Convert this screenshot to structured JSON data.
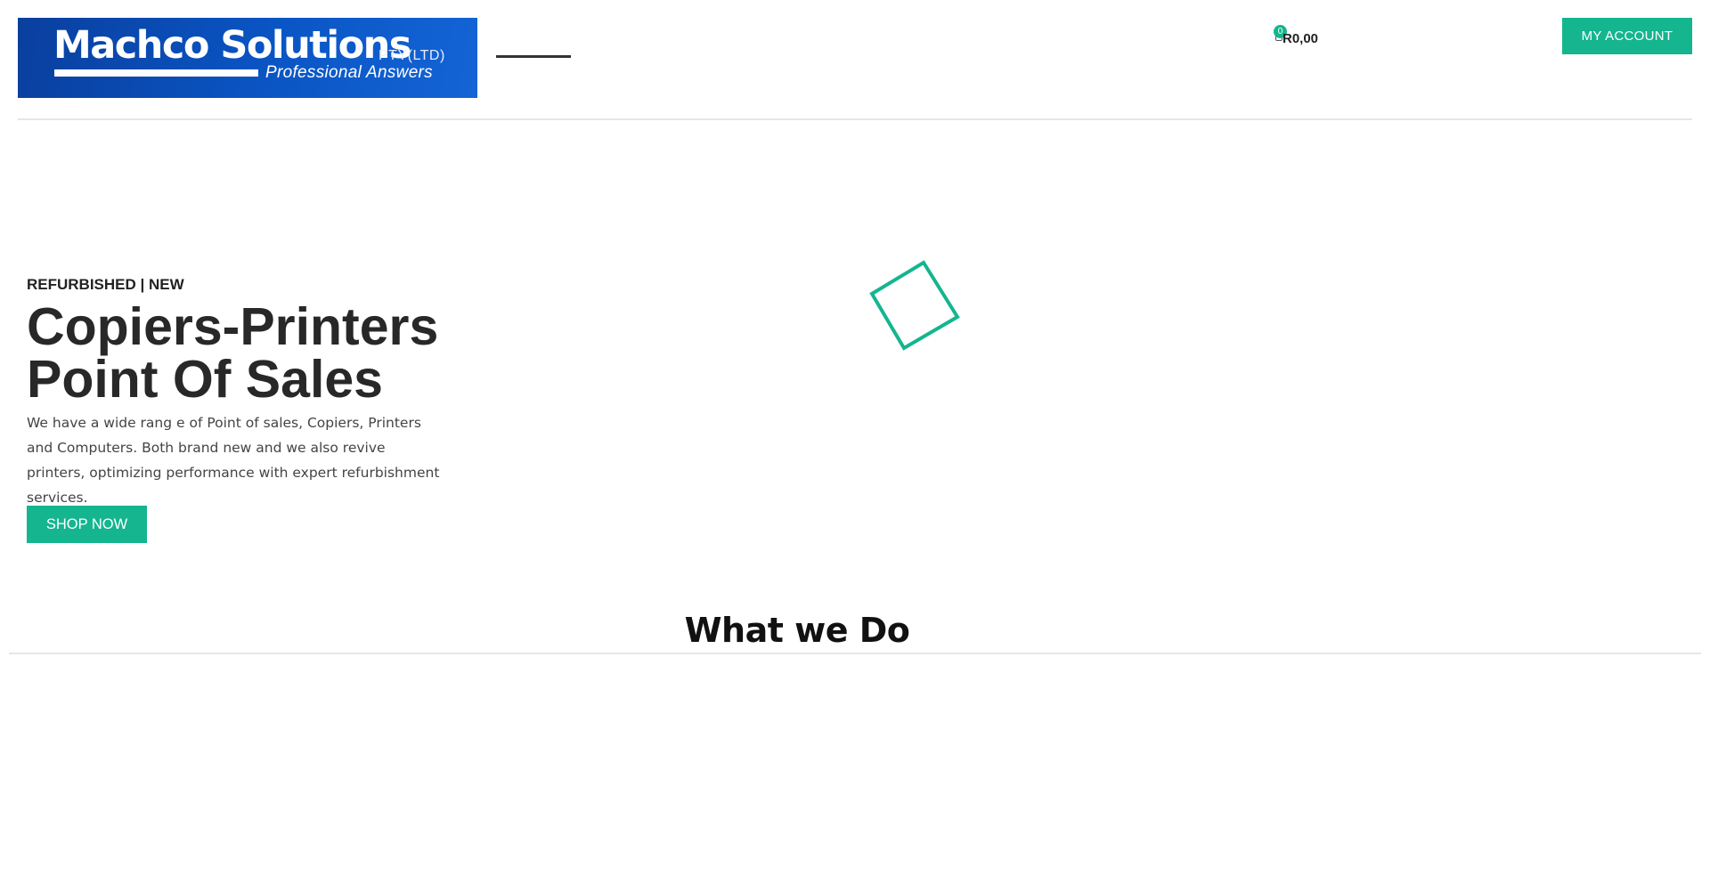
{
  "header": {
    "logo": {
      "brand": "Machco Solutions",
      "suffix": "PTY(LTD)",
      "tagline": "Professional Answers"
    },
    "cart": {
      "count": "0",
      "total": "R0,00",
      "icon": "cart-icon"
    },
    "account_label": "MY ACCOUNT"
  },
  "hero": {
    "eyebrow": "REFURBISHED | NEW",
    "title_line1": "Copiers-Printers",
    "title_line2": "Point Of Sales",
    "text": "We have a wide rang e of Point of sales, Copiers, Printers and Computers. Both brand new and we also revive printers, optimizing performance with expert refurbishment services.",
    "cta_label": "SHOP NOW"
  },
  "section": {
    "title": "What we Do"
  },
  "colors": {
    "accent": "#14b58f",
    "logo_bg": "#0a55c4",
    "text_dark": "#282828"
  }
}
